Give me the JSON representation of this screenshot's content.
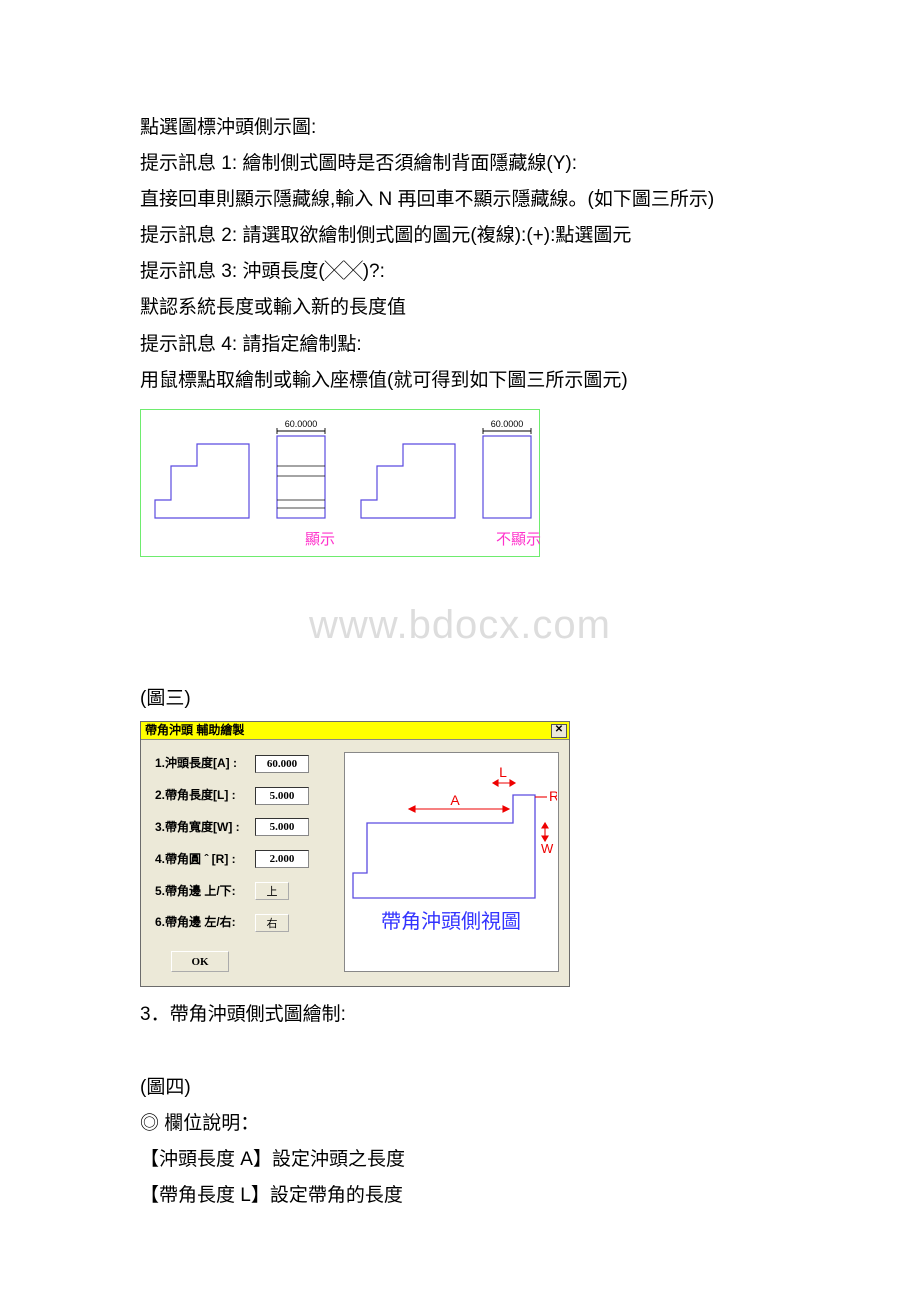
{
  "paragraphs": {
    "p1": "點選圖標沖頭側示圖:",
    "p2": "提示訊息 1: 繪制側式圖時是否須繪制背面隱藏線(Y):",
    "p3": "直接回車則顯示隱藏線,輸入 N 再回車不顯示隱藏線。(如下圖三所示)",
    "p4": "提示訊息 2: 請選取欲繪制側式圖的圖元(複線):(+):點選圖元",
    "p5": "提示訊息 3: 沖頭長度(╳╳)?:",
    "p6": "默認系統長度或輸入新的長度值",
    "p7": "提示訊息 4: 請指定繪制點:",
    "p8": "用鼠標點取繪制或輸入座標值(就可得到如下圖三所示圖元)"
  },
  "fig3": {
    "dim": "60.0000",
    "captionLeft": "顯示",
    "captionRight": "不顯示"
  },
  "watermark": "www.bdocx.com",
  "fig3_label": " (圖三)",
  "dialog": {
    "title": "帶角沖頭 輔助繪製",
    "labels": {
      "l1": "1.沖頭長度[A] :",
      "l2": "2.帶角長度[L] :",
      "l3": "3.帶角寬度[W] :",
      "l4": "4.帶角圓 ˆ [R] :",
      "l5": "5.帶角邊 上/下:",
      "l6": "6.帶角邊 左/右:"
    },
    "values": {
      "v1": "60.000",
      "v2": "5.000",
      "v3": "5.000",
      "v4": "2.000",
      "v5": "上",
      "v6": "右"
    },
    "ok": "OK",
    "preview_caption": "帶角沖頭側視圖",
    "annot": {
      "A": "A",
      "L": "L",
      "R": "R",
      "W": "W"
    }
  },
  "after": {
    "p1": "3．帶角沖頭側式圖繪制:",
    "p2": " (圖四)",
    "p3": "◎ 欄位說明：",
    "p4": "【沖頭長度 A】設定沖頭之長度",
    "p5": "【帶角長度 L】設定帶角的長度"
  }
}
